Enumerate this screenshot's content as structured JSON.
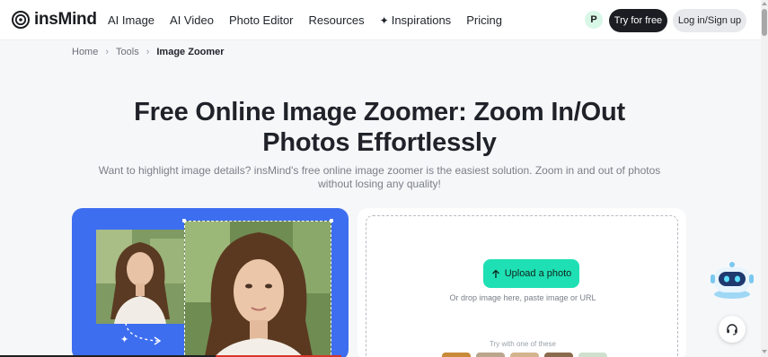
{
  "header": {
    "logo_text": "insMind",
    "nav": [
      "AI Image",
      "AI Video",
      "Photo Editor",
      "Resources",
      "Inspirations",
      "Pricing"
    ],
    "try_label": "Try for free",
    "login_label": "Log in/Sign up",
    "promo_icon": "P"
  },
  "breadcrumb": {
    "items": [
      "Home",
      "Tools"
    ],
    "current": "Image Zoomer"
  },
  "hero": {
    "title_line1": "Free Online Image Zoomer: Zoom In/Out",
    "title_line2": "Photos Effortlessly",
    "subtitle_line1": "Want to highlight image details? insMind's free online image zoomer is the easiest solution. Zoom in and out of photos",
    "subtitle_line2": "without losing any quality!"
  },
  "upload": {
    "button_label": "Upload a photo",
    "hint": "Or drop image here, paste image or URL",
    "try_label": "Try with one of these"
  },
  "colors": {
    "accent": "#1ee0b4",
    "demo_bg": "#3d6ef0",
    "dark_button": "#1b1d22"
  },
  "icons": {
    "logo": "insmind-logo-icon",
    "inspirations": "sparkle-icon",
    "upload": "upload-arrow-icon",
    "support": "headset-icon",
    "assistant": "robot-assistant-icon"
  }
}
